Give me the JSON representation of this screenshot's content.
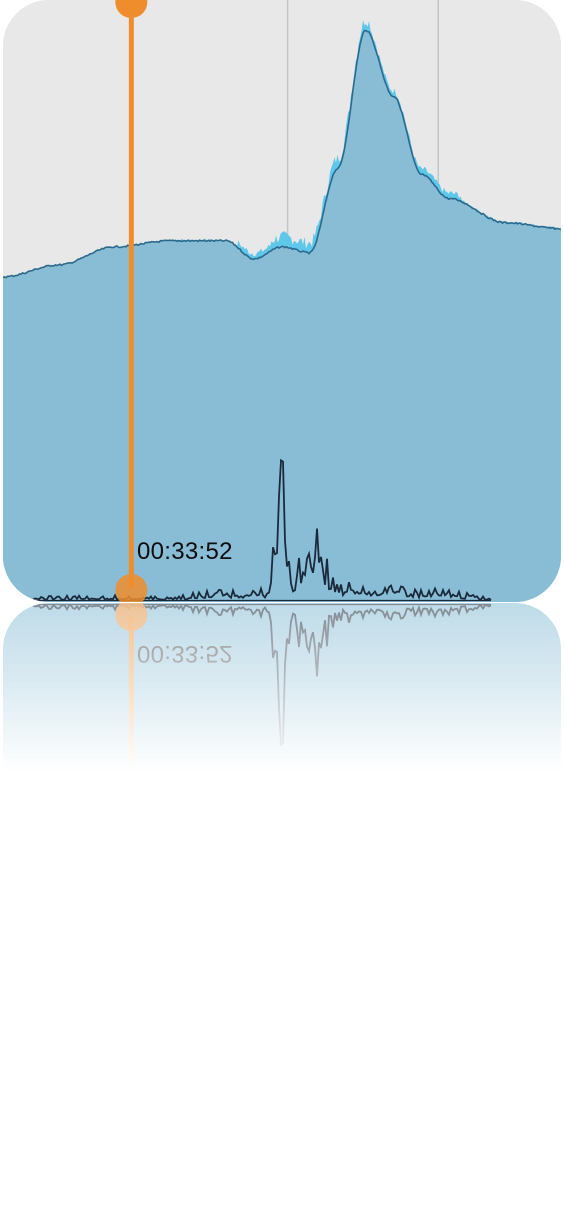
{
  "icon": {
    "name": "activity-graph-app-icon",
    "playhead_time": "00:33:52"
  },
  "colors": {
    "background": "#e8e8e8",
    "area_fill": "#89bdd6",
    "area_outline": "#2b6a8c",
    "peak_highlight": "#5fc7ea",
    "spike_line": "#1b2a3a",
    "gridline": "#c4c4c4",
    "playhead": "#ef8d2d"
  },
  "chart_data": {
    "type": "area",
    "title": "",
    "xlabel": "",
    "ylabel": "",
    "grid": true,
    "series": [
      {
        "x": [
          0,
          10,
          20,
          30,
          40,
          45,
          50,
          55,
          60,
          65,
          70,
          75,
          80,
          90,
          100
        ],
        "values": [
          54,
          56,
          59,
          60,
          60,
          57,
          59,
          58,
          72,
          95,
          84,
          71,
          67,
          63,
          62
        ]
      },
      {
        "x": [
          0,
          10,
          20,
          30,
          40,
          47,
          50,
          52,
          55,
          60,
          65,
          70,
          75,
          80,
          85,
          90,
          95,
          100
        ],
        "values": [
          1,
          1,
          1,
          1,
          2,
          2,
          19,
          4,
          14,
          3,
          3,
          3,
          2,
          2,
          1,
          1,
          1,
          1
        ]
      }
    ],
    "playhead_x": 23,
    "playhead_label": "00:33:52"
  }
}
